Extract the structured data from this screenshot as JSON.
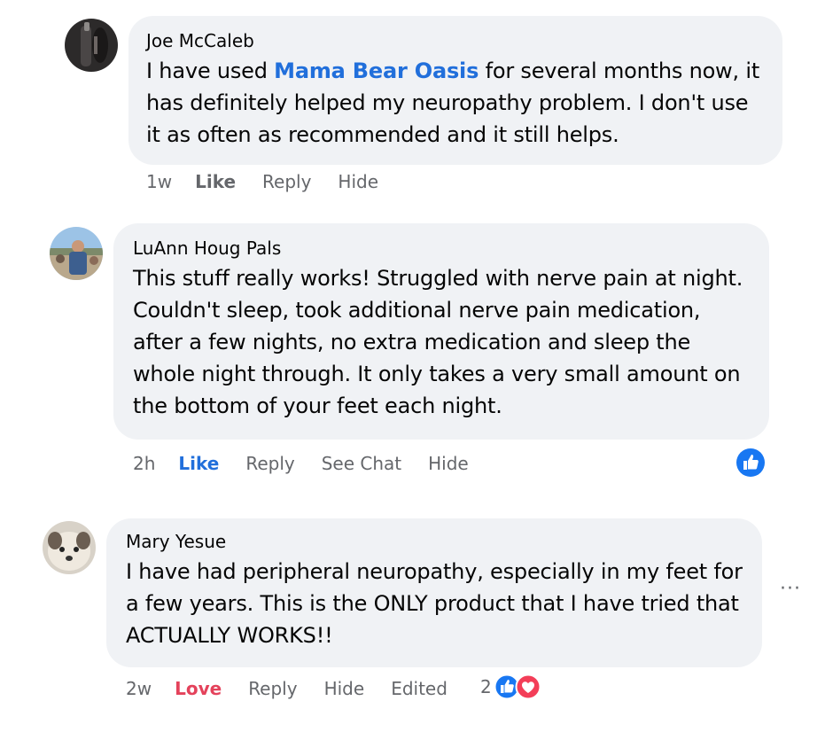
{
  "comments": [
    {
      "author": "Joe McCaleb",
      "text_before": "I have used ",
      "mention": "Mama Bear Oasis",
      "text_after": " for several months now, it has definitely helped my neuropathy problem. I don't use it as often as recommended and it still helps.",
      "time": "1w",
      "like_label": "Like",
      "reply_label": "Reply",
      "hide_label": "Hide"
    },
    {
      "author": "LuAnn Houg Pals",
      "text": "This stuff really works! Struggled with nerve pain at night. Couldn't sleep, took additional nerve pain medication, after a few nights, no extra medication and sleep the whole night through. It only takes a very small amount on the bottom of your feet each night.",
      "time": "2h",
      "like_label": "Like",
      "reply_label": "Reply",
      "see_chat_label": "See Chat",
      "hide_label": "Hide",
      "reaction_icon": "like-reaction-icon",
      "like_color": "#216fdb"
    },
    {
      "author": "Mary Yesue",
      "text": "I have had peripheral neuropathy, especially in my feet for a few years. This is the ONLY product that I have tried that ACTUALLY WORKS!!",
      "time": "2w",
      "love_label": "Love",
      "reply_label": "Reply",
      "hide_label": "Hide",
      "edited_label": "Edited",
      "reaction_count": "2",
      "reaction_icons": [
        "like-reaction-icon",
        "love-reaction-icon"
      ],
      "more_label": "···",
      "love_color": "#e4425b"
    }
  ],
  "colors": {
    "bubble": "#f0f2f5",
    "link": "#216fdb",
    "meta": "#65676b"
  }
}
